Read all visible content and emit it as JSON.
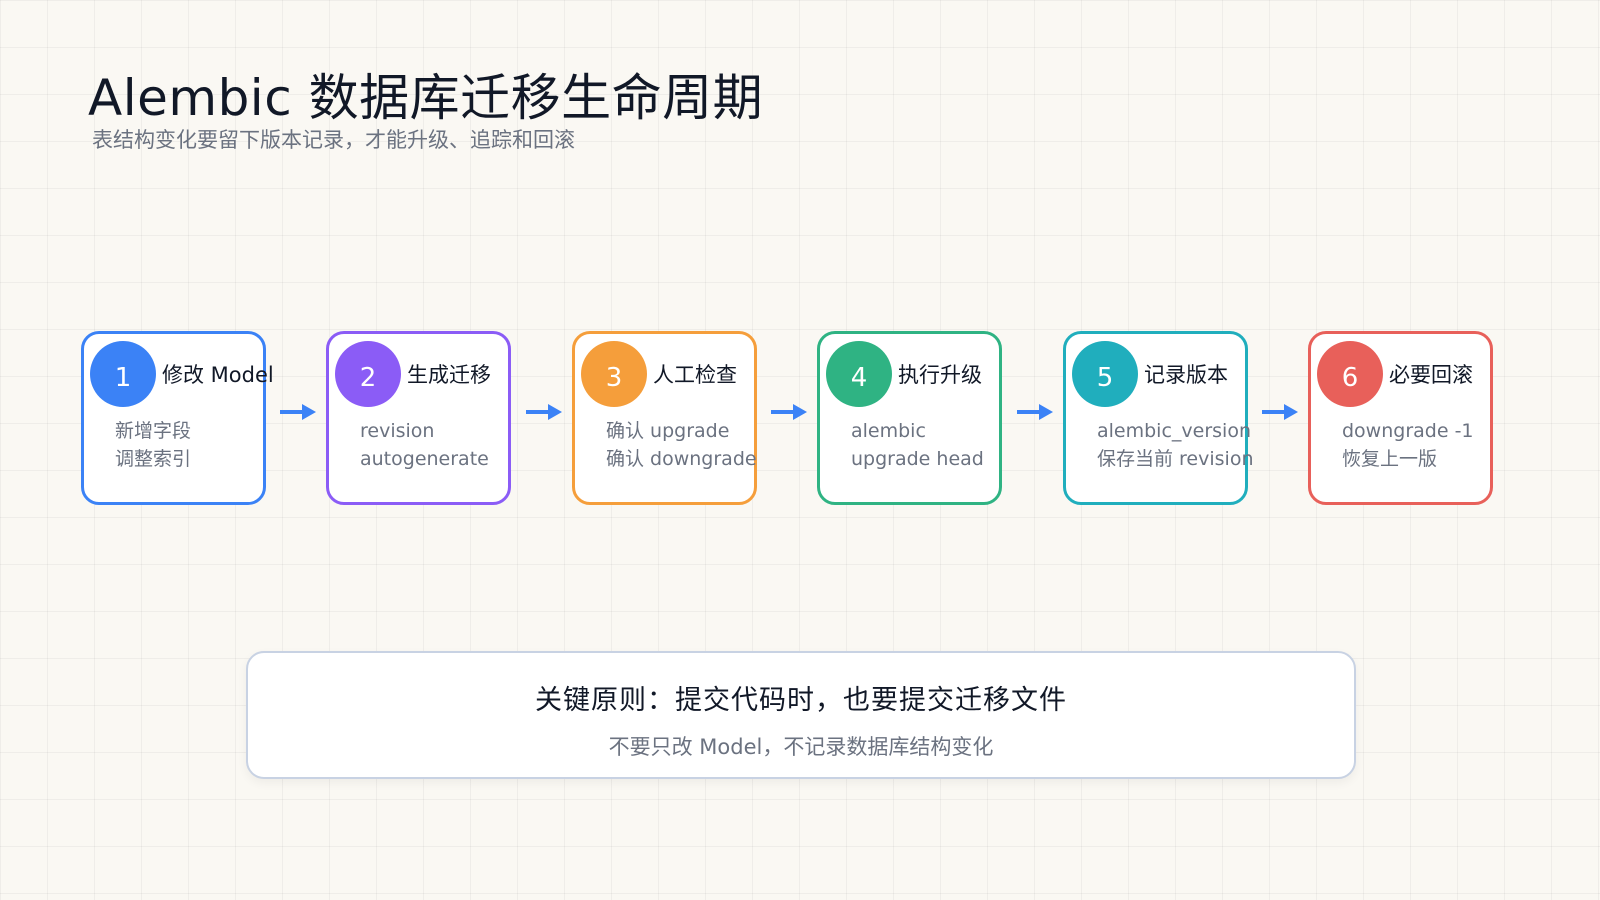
{
  "header": {
    "title": "Alembic 数据库迁移生命周期",
    "subtitle": "表结构变化要留下版本记录，才能升级、追踪和回滚"
  },
  "steps": [
    {
      "num": "1",
      "title": "修改 Model",
      "lines": [
        "新增字段",
        "调整索引"
      ],
      "color": "#3b82f6",
      "border": "#3b82f6"
    },
    {
      "num": "2",
      "title": "生成迁移",
      "lines": [
        "revision",
        "autogenerate"
      ],
      "color": "#8b5cf6",
      "border": "#8b5cf6"
    },
    {
      "num": "3",
      "title": "人工检查",
      "lines": [
        "确认 upgrade",
        "确认 downgrade"
      ],
      "color": "#f59e3b",
      "border": "#f59e3b"
    },
    {
      "num": "4",
      "title": "执行升级",
      "lines": [
        "alembic",
        "upgrade head"
      ],
      "color": "#2fb383",
      "border": "#2fb383"
    },
    {
      "num": "5",
      "title": "记录版本",
      "lines": [
        "alembic_version",
        "保存当前 revision"
      ],
      "color": "#20aebd",
      "border": "#20aebd"
    },
    {
      "num": "6",
      "title": "必要回滚",
      "lines": [
        "downgrade -1",
        "恢复上一版"
      ],
      "color": "#e8605a",
      "border": "#e8605a"
    }
  ],
  "arrow_color": "#3b82f6",
  "principle": {
    "title": "关键原则：提交代码时，也要提交迁移文件",
    "subtitle": "不要只改 Model，不记录数据库结构变化"
  }
}
